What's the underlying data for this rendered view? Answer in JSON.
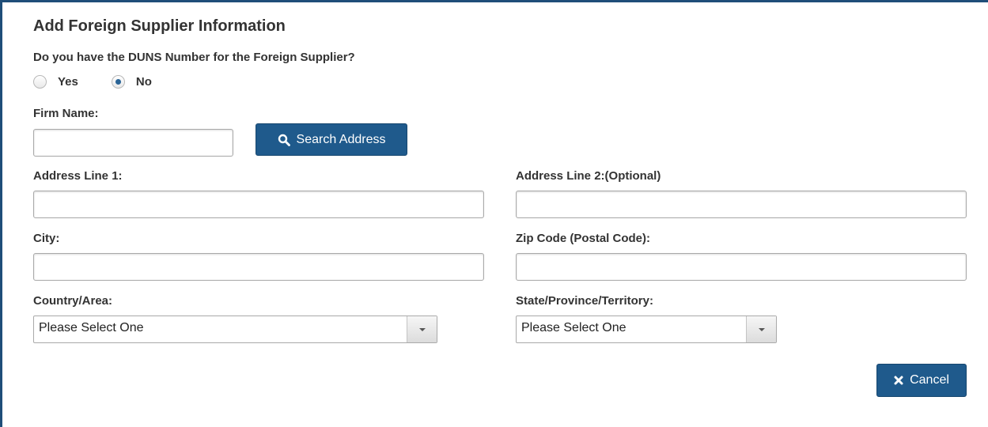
{
  "form": {
    "title": "Add Foreign Supplier Information",
    "duns_question": "Do you have the DUNS Number for the Foreign Supplier?",
    "duns_options": [
      {
        "label": "Yes",
        "checked": false
      },
      {
        "label": "No",
        "checked": true
      }
    ],
    "firm_name_label": "Firm Name:",
    "firm_name_value": "",
    "search_button_label": "Search Address",
    "address1_label": "Address Line 1:",
    "address1_value": "",
    "address2_label": "Address Line 2:(Optional)",
    "address2_value": "",
    "city_label": "City:",
    "city_value": "",
    "zip_label": "Zip Code (Postal Code):",
    "zip_value": "",
    "country_label": "Country/Area:",
    "country_selected": "Please Select One",
    "state_label": "State/Province/Territory:",
    "state_selected": "Please Select One",
    "cancel_button_label": "Cancel"
  },
  "colors": {
    "accent": "#1f5a8c",
    "frame_border": "#1f4e79",
    "label_text": "#333333"
  },
  "icons": {
    "search_button": "search-icon",
    "cancel_button": "close-icon",
    "dropdown": "chevron-down-icon"
  }
}
